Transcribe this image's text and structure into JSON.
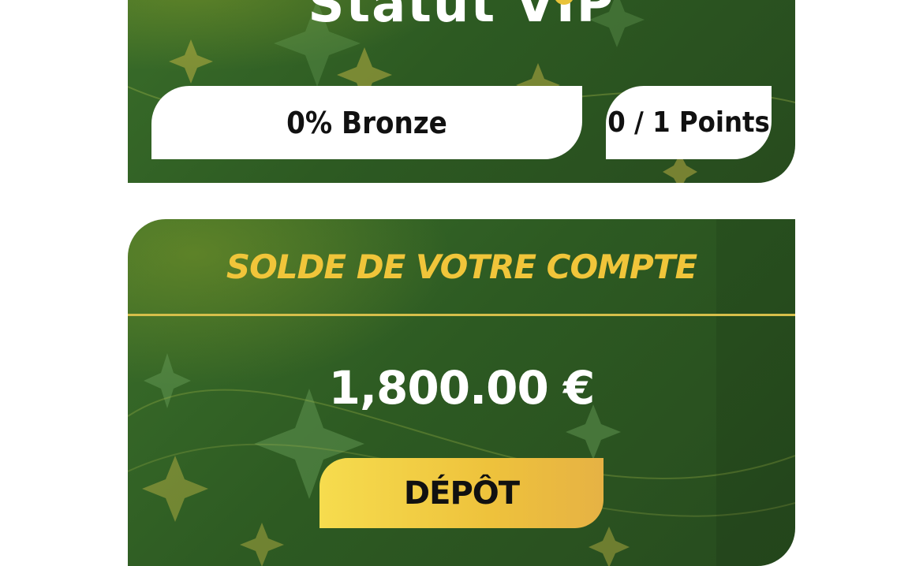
{
  "vip": {
    "title": "Statut VIP",
    "progress_text": "0% Bronze",
    "progress_percent": 0,
    "tier": "Bronze",
    "points_text": "0 / 1 Points",
    "points_current": 0,
    "points_required": 1
  },
  "balance": {
    "title": "SOLDE DE VOTRE COMPTE",
    "amount": "1,800.00 €",
    "deposit_label": "DÉPÔT"
  },
  "colors": {
    "card_green": "#2d5a22",
    "accent_gold": "#f0c53a",
    "pill_white": "#ffffff"
  }
}
